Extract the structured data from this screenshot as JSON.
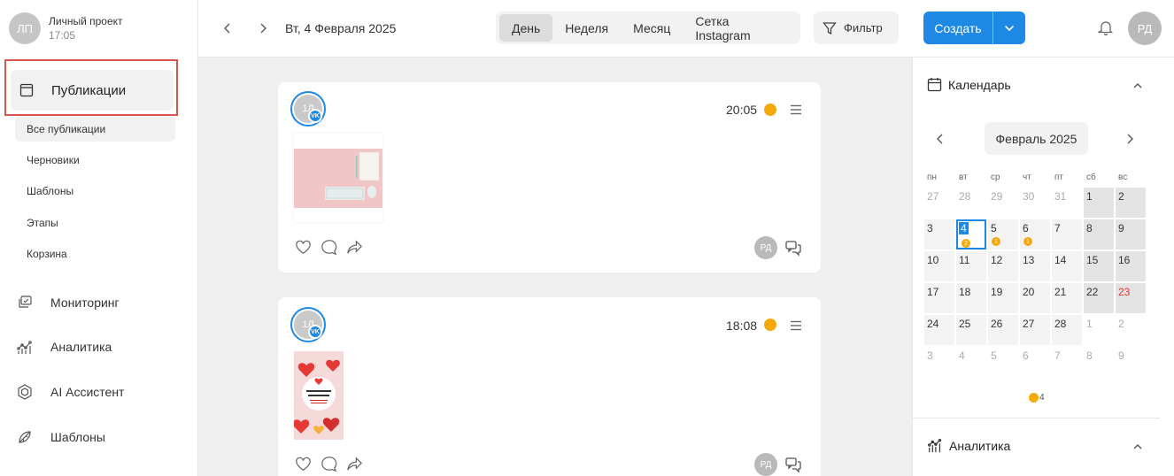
{
  "project": {
    "initials": "ЛП",
    "name": "Личный проект",
    "time": "17:05"
  },
  "sidebar": {
    "publications_label": "Публикации",
    "subitems": [
      "Все публикации",
      "Черновики",
      "Шаблоны",
      "Этапы",
      "Корзина"
    ],
    "items": [
      {
        "label": "Мониторинг",
        "icon": "monitoring-icon"
      },
      {
        "label": "Аналитика",
        "icon": "analytics-icon"
      },
      {
        "label": "AI Ассистент",
        "icon": "ai-icon"
      },
      {
        "label": "Шаблоны",
        "icon": "templates-icon"
      }
    ]
  },
  "header": {
    "date": "Вт, 4 Февраля 2025",
    "views": [
      "День",
      "Неделя",
      "Месяц",
      "Сетка Instagram"
    ],
    "active_view": "День",
    "filter_label": "Фильтр",
    "create_label": "Создать",
    "user_initials": "РД"
  },
  "posts": [
    {
      "account_initials": "1Л",
      "network": "VK",
      "time": "20:05",
      "status_color": "#f5a80a",
      "author": "РД"
    },
    {
      "account_initials": "1Л",
      "network": "VK",
      "time": "18:08",
      "status_color": "#f5a80a",
      "author": "РД"
    }
  ],
  "calendar": {
    "title": "Календарь",
    "month": "Февраль 2025",
    "weekdays": [
      "пн",
      "вт",
      "ср",
      "чт",
      "пт",
      "сб",
      "вс"
    ],
    "weeks": [
      [
        "27",
        "28",
        "29",
        "30",
        "31",
        "1",
        "2"
      ],
      [
        "3",
        "4",
        "5",
        "6",
        "7",
        "8",
        "9"
      ],
      [
        "10",
        "11",
        "12",
        "13",
        "14",
        "15",
        "16"
      ],
      [
        "17",
        "18",
        "19",
        "20",
        "21",
        "22",
        "23"
      ],
      [
        "24",
        "25",
        "26",
        "27",
        "28",
        "1",
        "2"
      ],
      [
        "3",
        "4",
        "5",
        "6",
        "7",
        "8",
        "9"
      ]
    ],
    "badges": {
      "4": "2",
      "5": "1",
      "6": "1"
    },
    "today": "4",
    "holiday": "23",
    "legend_count": "4",
    "accent": "#1e88e5",
    "badge_color": "#f5a80a"
  },
  "analytics_panel": {
    "title": "Аналитика"
  }
}
